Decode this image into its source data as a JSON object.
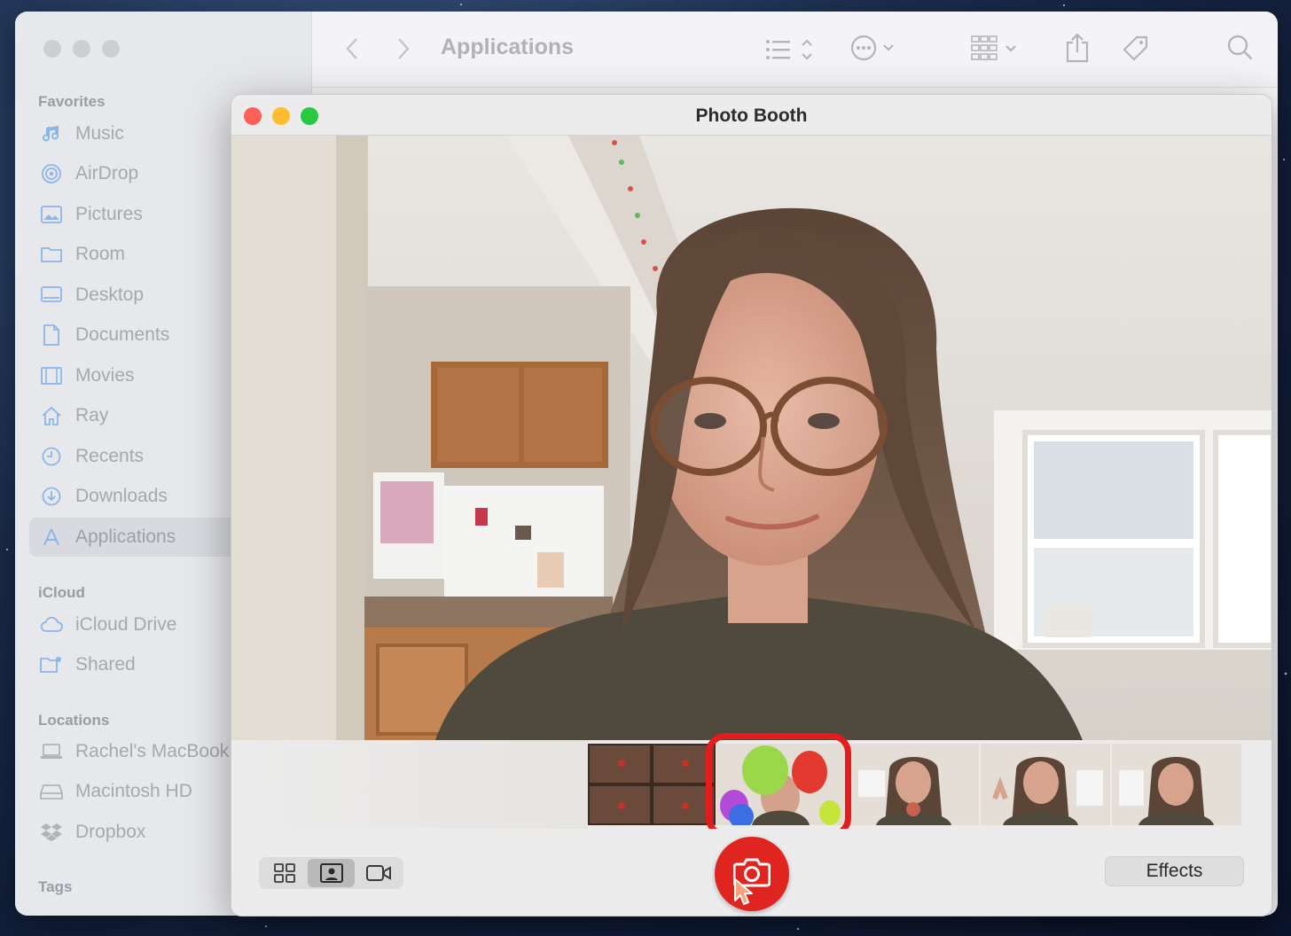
{
  "finder": {
    "title": "Applications",
    "sidebar": {
      "sections": [
        {
          "title": "Favorites"
        },
        {
          "title": "iCloud"
        },
        {
          "title": "Locations"
        },
        {
          "title": "Tags"
        }
      ],
      "favorites": [
        {
          "label": "Music",
          "icon": "music-note-icon"
        },
        {
          "label": "AirDrop",
          "icon": "airdrop-icon"
        },
        {
          "label": "Pictures",
          "icon": "pictures-icon"
        },
        {
          "label": "Room",
          "icon": "folder-icon"
        },
        {
          "label": "Desktop",
          "icon": "desktop-icon"
        },
        {
          "label": "Documents",
          "icon": "document-icon"
        },
        {
          "label": "Movies",
          "icon": "film-icon"
        },
        {
          "label": "Ray",
          "icon": "home-icon"
        },
        {
          "label": "Recents",
          "icon": "clock-icon"
        },
        {
          "label": "Downloads",
          "icon": "download-icon"
        },
        {
          "label": "Applications",
          "icon": "applications-icon",
          "selected": true
        }
      ],
      "icloud": [
        {
          "label": "iCloud Drive",
          "icon": "cloud-icon"
        },
        {
          "label": "Shared",
          "icon": "shared-folder-icon"
        }
      ],
      "locations": [
        {
          "label": "Rachel's MacBook",
          "icon": "laptop-icon"
        },
        {
          "label": "Macintosh HD",
          "icon": "disk-icon"
        },
        {
          "label": "Dropbox",
          "icon": "dropbox-icon"
        }
      ]
    }
  },
  "photobooth": {
    "title": "Photo Booth",
    "effects_label": "Effects",
    "view_modes": [
      "grid-view-icon",
      "single-photo-icon",
      "video-icon"
    ],
    "active_view_mode": "single-photo-icon",
    "shutter_icon": "camera-icon"
  },
  "colors": {
    "accent_red": "#e0241f",
    "highlight_red": "#e61c1c",
    "close": "#fe5f57",
    "minimize": "#febc2e",
    "zoom": "#28c840",
    "sidebar_icon": "#8cb6ea"
  }
}
